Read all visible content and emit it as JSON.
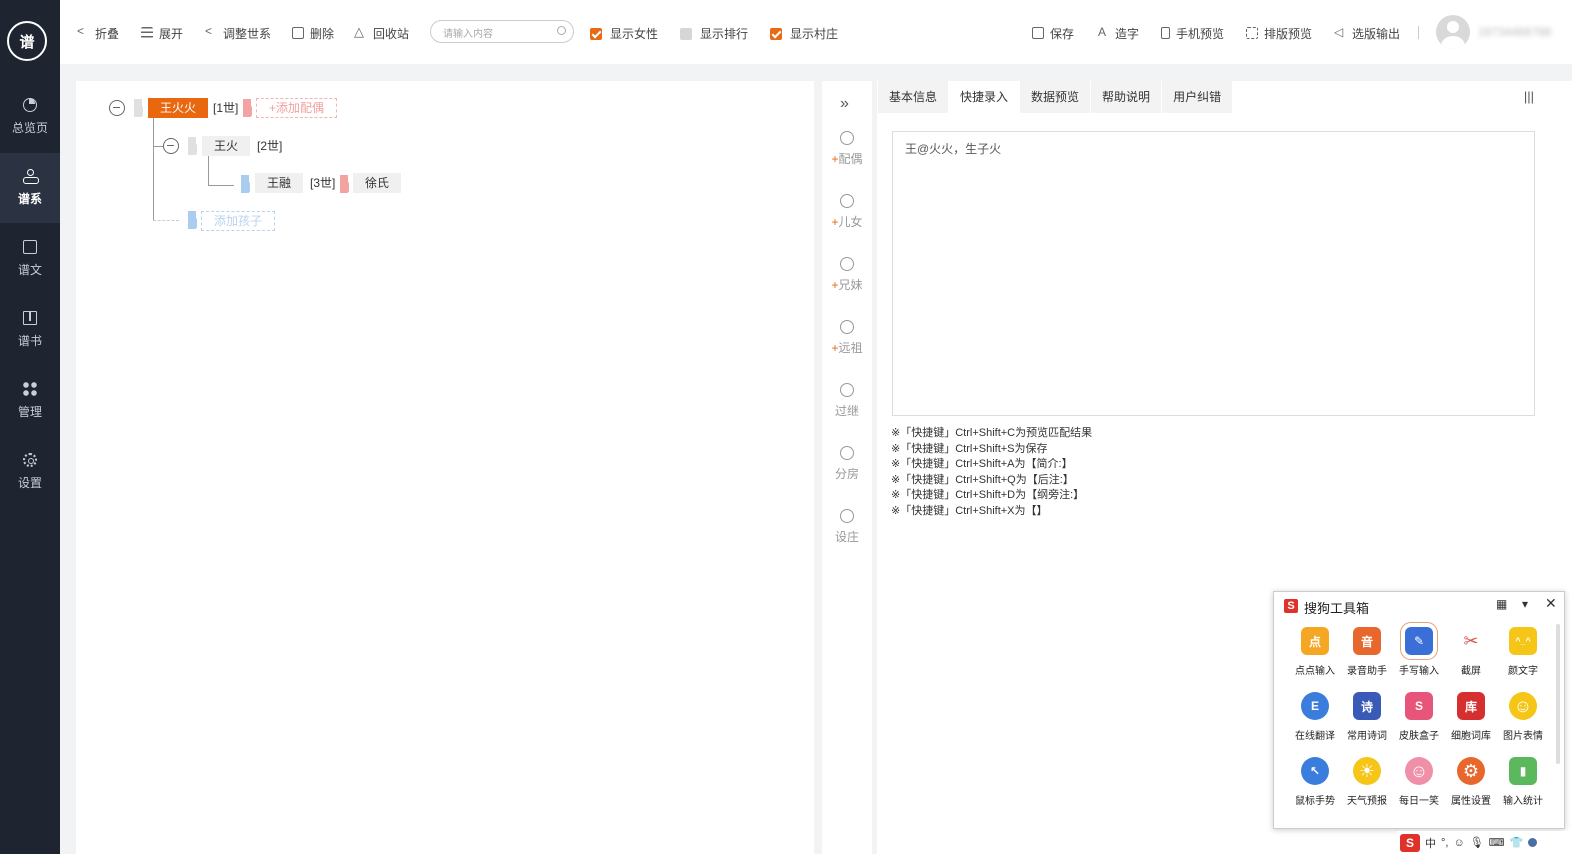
{
  "sidebar": {
    "logo": "谱",
    "items": [
      {
        "label": "总览页",
        "icon": "pie-chart-icon"
      },
      {
        "label": "谱系",
        "icon": "tree-icon",
        "active": true
      },
      {
        "label": "谱文",
        "icon": "document-icon"
      },
      {
        "label": "谱书",
        "icon": "book-icon"
      },
      {
        "label": "管理",
        "icon": "grid-icon"
      },
      {
        "label": "设置",
        "icon": "gear-icon"
      }
    ]
  },
  "toolbar": {
    "fold": "折叠",
    "expand": "展开",
    "adjust_generation": "调整世系",
    "delete": "删除",
    "recycle": "回收站",
    "search_placeholder": "请输入内容",
    "show_female": "显示女性",
    "show_rank": "显示排行",
    "show_village": "显示村庄",
    "save": "保存",
    "create_char": "造字",
    "mobile_preview": "手机预览",
    "layout_preview": "排版预览",
    "selected_output": "选版输出",
    "username": "18734466788"
  },
  "tree": {
    "root": {
      "name": "王火火",
      "gen": "[1世]",
      "add_spouse": "+添加配偶"
    },
    "child": {
      "name": "王火",
      "gen": "[2世]"
    },
    "grandchild": {
      "name": "王融",
      "gen": "[3世]",
      "spouse": "徐氏"
    },
    "add_child": "添加孩子"
  },
  "tools": {
    "items": [
      {
        "label": "配偶",
        "plus": "+"
      },
      {
        "label": "儿女",
        "plus": "+"
      },
      {
        "label": "兄妹",
        "plus": "+"
      },
      {
        "label": "远祖",
        "plus": "+"
      },
      {
        "label": "过继",
        "plus": ""
      },
      {
        "label": "分房",
        "plus": ""
      },
      {
        "label": "设庄",
        "plus": ""
      }
    ]
  },
  "panel": {
    "tabs": [
      "基本信息",
      "快捷录入",
      "数据预览",
      "帮助说明",
      "用户纠错"
    ],
    "active_tab": 1,
    "input_text": "王@火火，生子火",
    "hints": [
      "※「快捷键」Ctrl+Shift+C为预览匹配结果",
      "※「快捷键」Ctrl+Shift+S为保存",
      "※「快捷键」Ctrl+Shift+A为【简介:】",
      "※「快捷键」Ctrl+Shift+Q为【后注:】",
      "※「快捷键」Ctrl+Shift+D为【纲旁注:】",
      "※「快捷键」Ctrl+Shift+X为【】"
    ]
  },
  "sogou": {
    "title": "搜狗工具箱",
    "items": [
      {
        "label": "点点输入",
        "color": "#f5a623",
        "glyph": "点"
      },
      {
        "label": "录音助手",
        "color": "#e8672c",
        "glyph": "音"
      },
      {
        "label": "手写输入",
        "color": "#3a6fd8",
        "glyph": "✎"
      },
      {
        "label": "截屏",
        "color": "#d9534f",
        "glyph": "✂"
      },
      {
        "label": "颜文字",
        "color": "#f5c518",
        "glyph": "^_^"
      },
      {
        "label": "在线翻译",
        "color": "#3b7ddd",
        "glyph": "E"
      },
      {
        "label": "常用诗词",
        "color": "#3a5ab8",
        "glyph": "诗"
      },
      {
        "label": "皮肤盒子",
        "color": "#e8557a",
        "glyph": "S"
      },
      {
        "label": "细胞词库",
        "color": "#d62f2f",
        "glyph": "库"
      },
      {
        "label": "图片表情",
        "color": "#f5c518",
        "glyph": "☺"
      },
      {
        "label": "鼠标手势",
        "color": "#3b7ddd",
        "glyph": "↖"
      },
      {
        "label": "天气预报",
        "color": "#f5c518",
        "glyph": "☀"
      },
      {
        "label": "每日一笑",
        "color": "#f08fa8",
        "glyph": "☺"
      },
      {
        "label": "属性设置",
        "color": "#e8672c",
        "glyph": "⚙"
      },
      {
        "label": "输入统计",
        "color": "#5cb85c",
        "glyph": "▮"
      }
    ]
  },
  "taskbar": {
    "ime": "中",
    "punct": "°,"
  }
}
